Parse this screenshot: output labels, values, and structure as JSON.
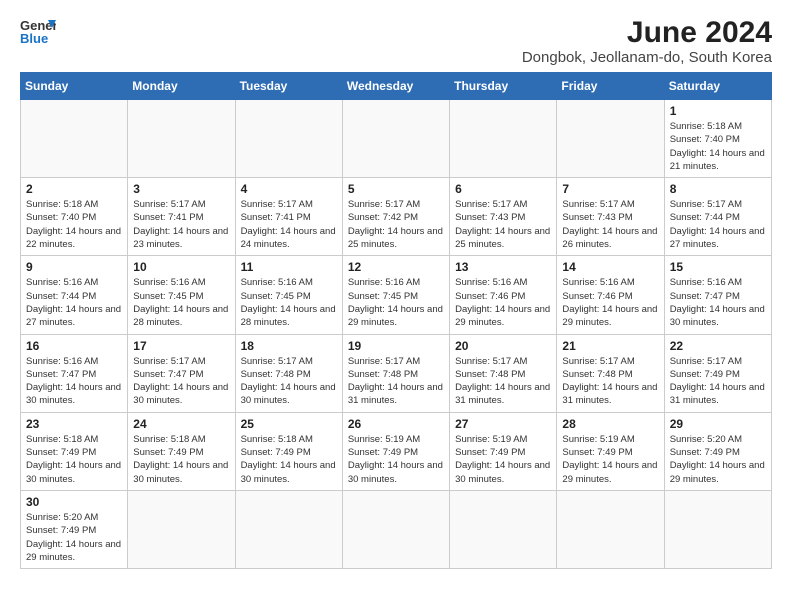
{
  "header": {
    "logo_line1": "General",
    "logo_line2": "Blue",
    "month_year": "June 2024",
    "location": "Dongbok, Jeollanam-do, South Korea"
  },
  "weekdays": [
    "Sunday",
    "Monday",
    "Tuesday",
    "Wednesday",
    "Thursday",
    "Friday",
    "Saturday"
  ],
  "weeks": [
    [
      {
        "day": "",
        "info": ""
      },
      {
        "day": "",
        "info": ""
      },
      {
        "day": "",
        "info": ""
      },
      {
        "day": "",
        "info": ""
      },
      {
        "day": "",
        "info": ""
      },
      {
        "day": "",
        "info": ""
      },
      {
        "day": "1",
        "info": "Sunrise: 5:18 AM\nSunset: 7:40 PM\nDaylight: 14 hours\nand 21 minutes."
      }
    ],
    [
      {
        "day": "2",
        "info": "Sunrise: 5:18 AM\nSunset: 7:40 PM\nDaylight: 14 hours\nand 22 minutes."
      },
      {
        "day": "3",
        "info": "Sunrise: 5:17 AM\nSunset: 7:41 PM\nDaylight: 14 hours\nand 23 minutes."
      },
      {
        "day": "4",
        "info": "Sunrise: 5:17 AM\nSunset: 7:41 PM\nDaylight: 14 hours\nand 24 minutes."
      },
      {
        "day": "5",
        "info": "Sunrise: 5:17 AM\nSunset: 7:42 PM\nDaylight: 14 hours\nand 25 minutes."
      },
      {
        "day": "6",
        "info": "Sunrise: 5:17 AM\nSunset: 7:43 PM\nDaylight: 14 hours\nand 25 minutes."
      },
      {
        "day": "7",
        "info": "Sunrise: 5:17 AM\nSunset: 7:43 PM\nDaylight: 14 hours\nand 26 minutes."
      },
      {
        "day": "8",
        "info": "Sunrise: 5:17 AM\nSunset: 7:44 PM\nDaylight: 14 hours\nand 27 minutes."
      }
    ],
    [
      {
        "day": "9",
        "info": "Sunrise: 5:16 AM\nSunset: 7:44 PM\nDaylight: 14 hours\nand 27 minutes."
      },
      {
        "day": "10",
        "info": "Sunrise: 5:16 AM\nSunset: 7:45 PM\nDaylight: 14 hours\nand 28 minutes."
      },
      {
        "day": "11",
        "info": "Sunrise: 5:16 AM\nSunset: 7:45 PM\nDaylight: 14 hours\nand 28 minutes."
      },
      {
        "day": "12",
        "info": "Sunrise: 5:16 AM\nSunset: 7:45 PM\nDaylight: 14 hours\nand 29 minutes."
      },
      {
        "day": "13",
        "info": "Sunrise: 5:16 AM\nSunset: 7:46 PM\nDaylight: 14 hours\nand 29 minutes."
      },
      {
        "day": "14",
        "info": "Sunrise: 5:16 AM\nSunset: 7:46 PM\nDaylight: 14 hours\nand 29 minutes."
      },
      {
        "day": "15",
        "info": "Sunrise: 5:16 AM\nSunset: 7:47 PM\nDaylight: 14 hours\nand 30 minutes."
      }
    ],
    [
      {
        "day": "16",
        "info": "Sunrise: 5:16 AM\nSunset: 7:47 PM\nDaylight: 14 hours\nand 30 minutes."
      },
      {
        "day": "17",
        "info": "Sunrise: 5:17 AM\nSunset: 7:47 PM\nDaylight: 14 hours\nand 30 minutes."
      },
      {
        "day": "18",
        "info": "Sunrise: 5:17 AM\nSunset: 7:48 PM\nDaylight: 14 hours\nand 30 minutes."
      },
      {
        "day": "19",
        "info": "Sunrise: 5:17 AM\nSunset: 7:48 PM\nDaylight: 14 hours\nand 31 minutes."
      },
      {
        "day": "20",
        "info": "Sunrise: 5:17 AM\nSunset: 7:48 PM\nDaylight: 14 hours\nand 31 minutes."
      },
      {
        "day": "21",
        "info": "Sunrise: 5:17 AM\nSunset: 7:48 PM\nDaylight: 14 hours\nand 31 minutes."
      },
      {
        "day": "22",
        "info": "Sunrise: 5:17 AM\nSunset: 7:49 PM\nDaylight: 14 hours\nand 31 minutes."
      }
    ],
    [
      {
        "day": "23",
        "info": "Sunrise: 5:18 AM\nSunset: 7:49 PM\nDaylight: 14 hours\nand 30 minutes."
      },
      {
        "day": "24",
        "info": "Sunrise: 5:18 AM\nSunset: 7:49 PM\nDaylight: 14 hours\nand 30 minutes."
      },
      {
        "day": "25",
        "info": "Sunrise: 5:18 AM\nSunset: 7:49 PM\nDaylight: 14 hours\nand 30 minutes."
      },
      {
        "day": "26",
        "info": "Sunrise: 5:19 AM\nSunset: 7:49 PM\nDaylight: 14 hours\nand 30 minutes."
      },
      {
        "day": "27",
        "info": "Sunrise: 5:19 AM\nSunset: 7:49 PM\nDaylight: 14 hours\nand 30 minutes."
      },
      {
        "day": "28",
        "info": "Sunrise: 5:19 AM\nSunset: 7:49 PM\nDaylight: 14 hours\nand 29 minutes."
      },
      {
        "day": "29",
        "info": "Sunrise: 5:20 AM\nSunset: 7:49 PM\nDaylight: 14 hours\nand 29 minutes."
      }
    ],
    [
      {
        "day": "30",
        "info": "Sunrise: 5:20 AM\nSunset: 7:49 PM\nDaylight: 14 hours\nand 29 minutes."
      },
      {
        "day": "",
        "info": ""
      },
      {
        "day": "",
        "info": ""
      },
      {
        "day": "",
        "info": ""
      },
      {
        "day": "",
        "info": ""
      },
      {
        "day": "",
        "info": ""
      },
      {
        "day": "",
        "info": ""
      }
    ]
  ]
}
